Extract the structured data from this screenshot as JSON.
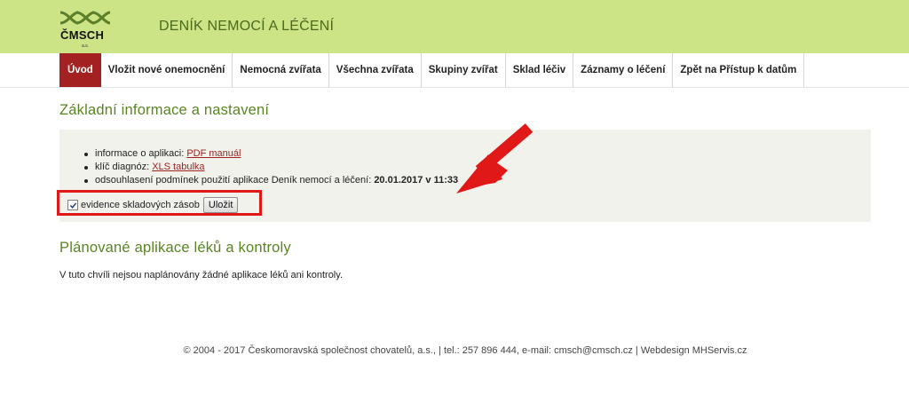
{
  "header": {
    "logo_text": "ČMSCH",
    "logo_sub": "a.s.",
    "title": "DENÍK NEMOCÍ A LÉČENÍ",
    "bg_color": "#cde486"
  },
  "nav": {
    "items": [
      {
        "label": "Úvod",
        "active": true
      },
      {
        "label": "Vložit nové onemocnění"
      },
      {
        "label": "Nemocná zvířata"
      },
      {
        "label": "Všechna zvířata"
      },
      {
        "label": "Skupiny zvířat"
      },
      {
        "label": "Sklad léčiv"
      },
      {
        "label": "Záznamy o léčení"
      },
      {
        "label": "Zpět na Přístup k datům"
      }
    ],
    "active_color": "#a32121"
  },
  "basic": {
    "heading": "Základní informace a nastavení",
    "items": [
      {
        "prefix": "informace o aplikaci: ",
        "link": "PDF manuál"
      },
      {
        "prefix": "klíč diagnóz: ",
        "link": "XLS tabulka"
      },
      {
        "prefix": "odsouhlasení podmínek použití aplikace Deník nemocí a léčení: ",
        "value": "20.01.2017 v 11:33"
      }
    ],
    "stock_checkbox_label": "evidence skladových zásob",
    "stock_checked": true,
    "save_label": "Uložit"
  },
  "planned": {
    "heading": "Plánované aplikace léků a kontroly",
    "text": "V tuto chvíli nejsou naplánovány žádné aplikace léků ani kontroly."
  },
  "footer": {
    "text": "© 2004 - 2017 Českomoravská společnost chovatelů, a.s., | tel.: 257 896 444, e-mail: cmsch@cmsch.cz | Webdesign MHServis.cz"
  },
  "annotation_color": "#e01818"
}
